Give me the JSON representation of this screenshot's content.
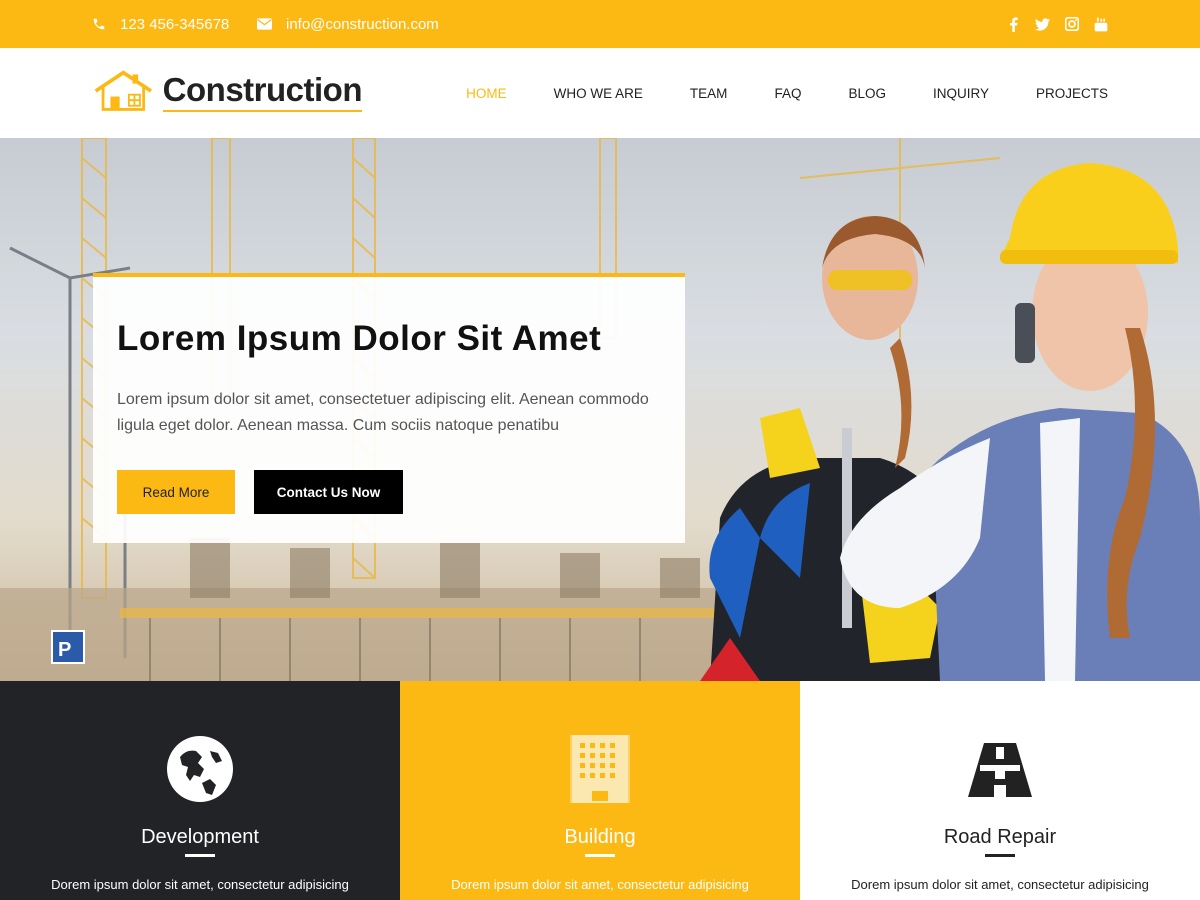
{
  "topbar": {
    "phone": "123 456-345678",
    "email": "info@construction.com",
    "phone_icon": "phone-icon",
    "email_icon": "envelope-icon",
    "social": [
      "facebook-icon",
      "twitter-icon",
      "instagram-icon",
      "youtube-icon"
    ]
  },
  "logo": {
    "text": "Construction",
    "icon": "house-icon"
  },
  "nav": {
    "items": [
      {
        "label": "HOME",
        "active": true
      },
      {
        "label": "WHO WE ARE"
      },
      {
        "label": "TEAM"
      },
      {
        "label": "FAQ"
      },
      {
        "label": "BLOG"
      },
      {
        "label": "INQUIRY"
      },
      {
        "label": "PROJECTS"
      }
    ]
  },
  "hero": {
    "title": "Lorem Ipsum Dolor Sit Amet",
    "text": "Lorem ipsum dolor sit amet, consectetuer adipiscing elit. Aenean commodo ligula eget dolor. Aenean massa. Cum sociis natoque penatibu",
    "read_more": "Read More",
    "contact": "Contact Us Now"
  },
  "features": [
    {
      "title": "Development",
      "text": "Dorem ipsum dolor sit amet, consectetur adipisicing",
      "icon": "globe-icon"
    },
    {
      "title": "Building",
      "text": "Dorem ipsum dolor sit amet, consectetur adipisicing",
      "icon": "building-icon"
    },
    {
      "title": "Road Repair",
      "text": "Dorem ipsum dolor sit amet, consectetur adipisicing",
      "icon": "road-icon"
    }
  ],
  "colors": {
    "accent": "#fdb913",
    "dark": "#222327"
  }
}
